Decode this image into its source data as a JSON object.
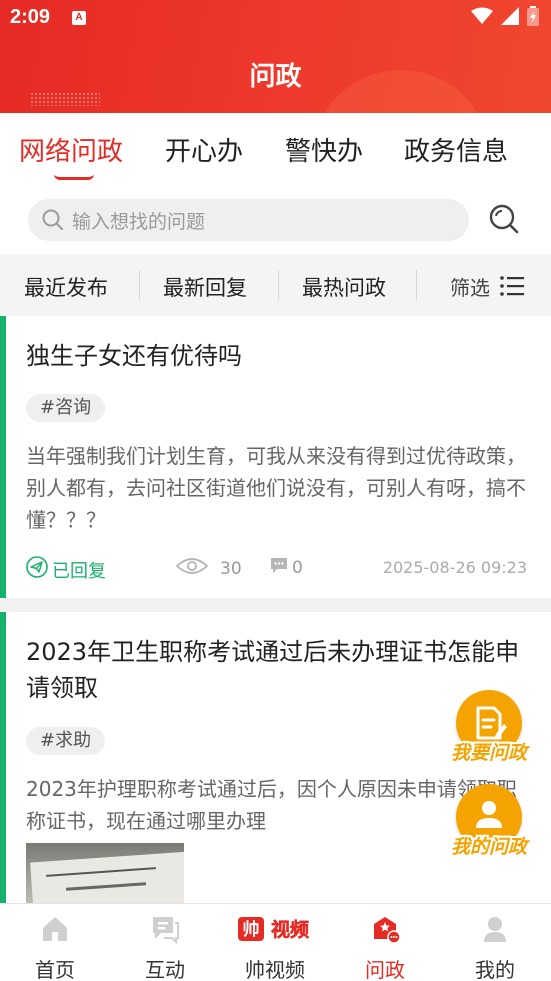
{
  "status_bar": {
    "time": "2:09",
    "notification_letter": "A"
  },
  "header": {
    "title": "问政"
  },
  "tabs": [
    {
      "label": "网络问政",
      "active": true
    },
    {
      "label": "开心办",
      "active": false
    },
    {
      "label": "警快办",
      "active": false
    },
    {
      "label": "政务信息",
      "active": false
    }
  ],
  "search": {
    "placeholder": "输入想找的问题"
  },
  "sort": {
    "items": [
      "最近发布",
      "最新回复",
      "最热问政"
    ],
    "filter_label": "筛选"
  },
  "posts": [
    {
      "title": "独生子女还有优待吗",
      "tag": "#咨询",
      "body": "当年强制我们计划生育，可我从来没有得到过优待政策，别人都有，去问社区街道他们说没有，可别人有呀，搞不懂？？？",
      "status": "已回复",
      "views": "30",
      "comments": "0",
      "time": "2025-08-26 09:23"
    },
    {
      "title": "2023年卫生职称考试通过后未办理证书怎能申请领取",
      "tag": "#求助",
      "body": "2023年护理职称考试通过后，因个人原因未申请领取职称证书，现在通过哪里办理"
    }
  ],
  "fabs": {
    "ask": "我要问政",
    "mine": "我的问政"
  },
  "bottom_nav": [
    {
      "label": "首页",
      "active": false
    },
    {
      "label": "互动",
      "active": false
    },
    {
      "label": "帅视频",
      "active": false,
      "logo": "帅视频"
    },
    {
      "label": "问政",
      "active": true
    },
    {
      "label": "我的",
      "active": false
    }
  ],
  "colors": {
    "brand_red": "#e62a24",
    "accent_green": "#17b26a",
    "fab_orange": "#f5a300"
  }
}
